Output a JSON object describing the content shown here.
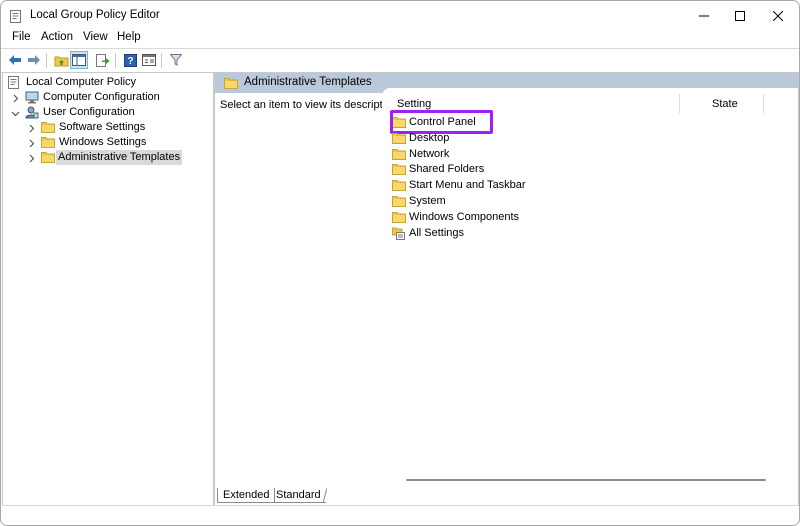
{
  "window": {
    "title": "Local Group Policy Editor",
    "controls": {
      "minimize": "minimize",
      "maximize": "maximize",
      "close": "close"
    }
  },
  "menubar": {
    "items": [
      "File",
      "Action",
      "View",
      "Help"
    ]
  },
  "toolbar": {
    "buttons": [
      "back-arrow-icon",
      "forward-arrow-icon",
      "up-folder-icon",
      "show-hide-tree-icon",
      "export-list-icon",
      "help-icon",
      "properties-icon",
      "filter-icon"
    ]
  },
  "tree": {
    "root": "Local Computer Policy",
    "items": [
      {
        "label": "Computer Configuration",
        "expanded": false
      },
      {
        "label": "User Configuration",
        "expanded": true
      },
      {
        "label": "Software Settings",
        "expanded": false
      },
      {
        "label": "Windows Settings",
        "expanded": false
      },
      {
        "label": "Administrative Templates",
        "expanded": false,
        "selected": true
      }
    ]
  },
  "right_pane": {
    "header": "Administrative Templates",
    "description": "Select an item to view its description.",
    "columns": [
      "Setting",
      "State"
    ],
    "items": [
      "Control Panel",
      "Desktop",
      "Network",
      "Shared Folders",
      "Start Menu and Taskbar",
      "System",
      "Windows Components",
      "All Settings"
    ],
    "highlighted_item": "Control Panel",
    "highlight_color": "#a020f0"
  },
  "tabs": [
    "Extended",
    "Standard"
  ],
  "colors": {
    "pane_header": "#b9c9d9",
    "selection": "#d9d9d9",
    "folder": "#f2c744"
  }
}
